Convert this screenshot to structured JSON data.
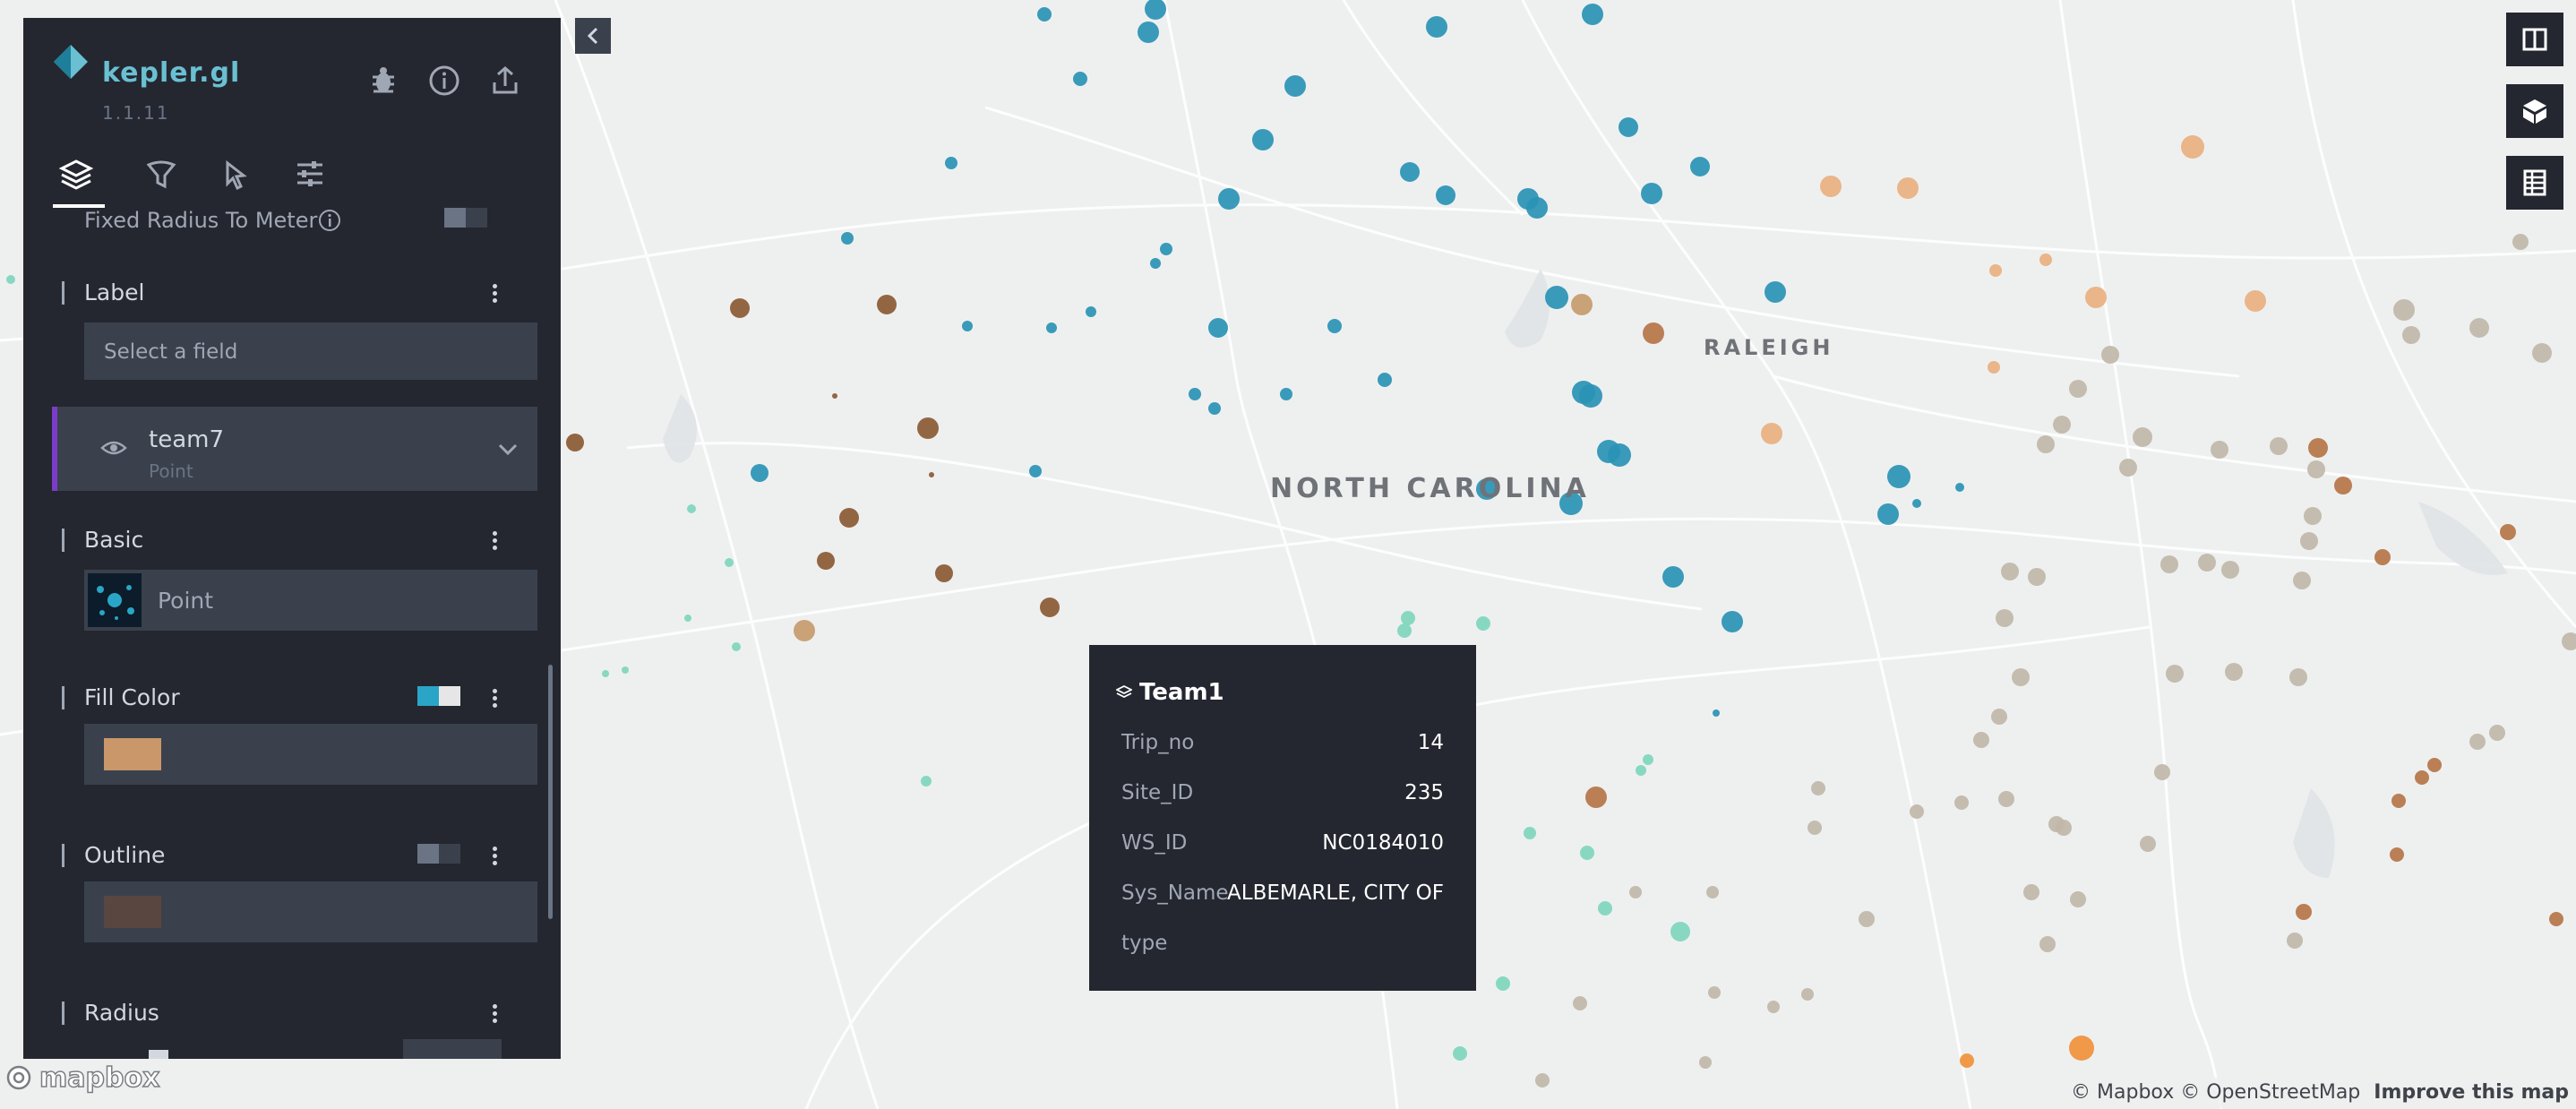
{
  "app": {
    "title": "kepler.gl",
    "version": "1.1.11"
  },
  "map": {
    "state_label": "NORTH CAROLINA",
    "city_label": "RALEIGH"
  },
  "panel": {
    "fixed_radius_label": "Fixed Radius To Meter",
    "label_section": "Label",
    "label_placeholder": "Select a field",
    "layer": {
      "name": "team7",
      "type": "Point"
    },
    "basic_section": "Basic",
    "basic_value": "Point",
    "fill_color_section": "Fill Color",
    "fill_color": "#c9976a",
    "outline_section": "Outline",
    "outline_color": "#5a4640",
    "radius_section": "Radius"
  },
  "icons": {
    "header": [
      "bug-icon",
      "info-icon",
      "share-icon"
    ],
    "tabs": [
      "layers-icon",
      "filter-icon",
      "interaction-icon",
      "map-style-icon"
    ],
    "right": [
      "split-map-icon",
      "3d-map-icon",
      "data-table-icon"
    ]
  },
  "colors": {
    "panel_bg": "#242730",
    "accent": "#6ac0d2",
    "layer_border": "#7a3cc9",
    "map_bg": "#eef0f0",
    "pin": "#2aa86b"
  },
  "tooltip": {
    "title": "Team1",
    "rows": [
      {
        "key": "Trip_no",
        "value": "14"
      },
      {
        "key": "Site_ID",
        "value": "235"
      },
      {
        "key": "WS_ID",
        "value": "NC0184010"
      },
      {
        "key": "Sys_Name",
        "value": "ALBEMARLE, CITY OF"
      },
      {
        "key": "type",
        "value": ""
      }
    ]
  },
  "attribution": {
    "mapbox": "© Mapbox",
    "osm": "© OpenStreetMap",
    "improve": "Improve this map",
    "logo_text": "mapbox"
  }
}
